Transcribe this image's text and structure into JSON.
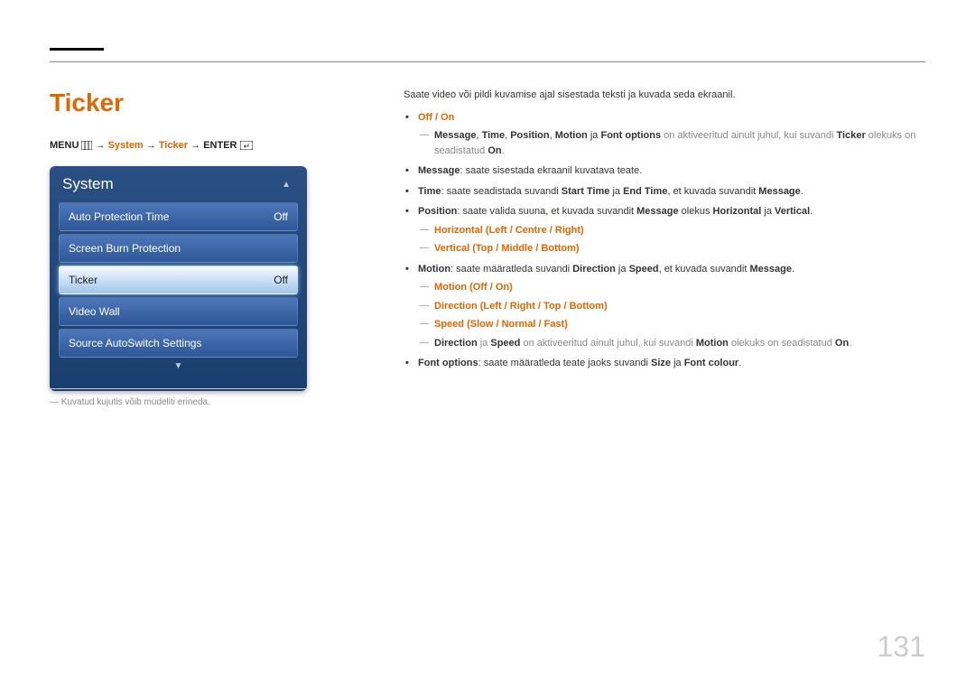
{
  "title": "Ticker",
  "breadcrumb": {
    "menu": "MENU",
    "arrow": " → ",
    "system": "System",
    "ticker": "Ticker",
    "enter": "ENTER"
  },
  "panel": {
    "header": "System",
    "items": [
      {
        "label": "Auto Protection Time",
        "value": "Off",
        "selected": false
      },
      {
        "label": "Screen Burn Protection",
        "value": "",
        "selected": false
      },
      {
        "label": "Ticker",
        "value": "Off",
        "selected": true
      },
      {
        "label": "Video Wall",
        "value": "",
        "selected": false
      },
      {
        "label": "Source AutoSwitch Settings",
        "value": "",
        "selected": false
      }
    ]
  },
  "footnote": "Kuvatud kujutis võib mudeliti erineda.",
  "right": {
    "intro": "Saate video või pildi kuvamise ajal sisestada teksti ja kuvada seda ekraanil.",
    "b1a": {
      "off": "Off",
      "sep": " / ",
      "on": "On"
    },
    "b1a_sub": {
      "pre": "",
      "msg": "Message",
      "c1": ", ",
      "time": "Time",
      "c2": ", ",
      "pos": "Position",
      "c3": ", ",
      "mot": "Motion",
      "t_ja1": " ja ",
      "fo": "Font options",
      "rest1": " on aktiveeritud ainult juhul, kui suvandi ",
      "tick": "Ticker",
      "rest2": " olekuks on seadistatud ",
      "on2": "On",
      "dot": "."
    },
    "b1b": {
      "msg": "Message",
      "txt": ": saate sisestada ekraanil kuvatava teate."
    },
    "b1c": {
      "time": "Time",
      "txt1": ": saate seadistada suvandi ",
      "st": "Start Time",
      "ja": " ja ",
      "et": "End Time",
      "txt2": ", et kuvada suvandit ",
      "msg": "Message",
      "dot": "."
    },
    "b1d": {
      "pos": "Position",
      "txt1": ": saate valida suuna, et kuvada suvandit ",
      "msg": "Message",
      "txt2": " olekus ",
      "hor": "Horizontal",
      "ja": " ja ",
      "ver": "Vertical",
      "dot": "."
    },
    "b1d_sub": [
      {
        "k": "Horizontal",
        "p1": " (",
        "v1": "Left",
        "s1": " / ",
        "v2": "Centre",
        "s2": " / ",
        "v3": "Right",
        "p2": ")"
      },
      {
        "k": "Vertical",
        "p1": " (",
        "v1": "Top",
        "s1": " / ",
        "v2": "Middle",
        "s2": " / ",
        "v3": "Bottom",
        "p2": ")"
      }
    ],
    "b1e": {
      "mot": "Motion",
      "txt1": ": saate määratleda suvandi ",
      "dir": "Direction",
      "ja": " ja ",
      "sp": "Speed",
      "txt2": ", et kuvada suvandit ",
      "msg": "Message",
      "dot": "."
    },
    "b1e_sub": [
      {
        "k": "Motion",
        "p1": " (",
        "v1": "Off",
        "s1": " / ",
        "v2": "On",
        "p2": ")"
      },
      {
        "k": "Direction",
        "p1": " (",
        "v1": "Left",
        "s1": " / ",
        "v2": "Right",
        "s2": " / ",
        "v3": "Top",
        "s3": " / ",
        "v4": "Bottom",
        "p2": ")"
      },
      {
        "k": "Speed",
        "p1": " (",
        "v1": "Slow",
        "s1": " / ",
        "v2": "Normal",
        "s2": " / ",
        "v3": "Fast",
        "p2": ")"
      }
    ],
    "b1e_sub4": {
      "dir": "Direction",
      "ja1": " ja ",
      "sp": "Speed",
      "txt1": " on aktiveeritud ainult juhul, kui suvandi ",
      "mot": "Motion",
      "txt2": " olekuks on seadistatud ",
      "on": "On",
      "dot": "."
    },
    "b1f": {
      "fo": "Font options",
      "txt1": ": saate määratleda teate jaoks suvandi ",
      "sz": "Size",
      "ja": " ja ",
      "fc": "Font colour",
      "dot": "."
    }
  },
  "page_number": "131"
}
